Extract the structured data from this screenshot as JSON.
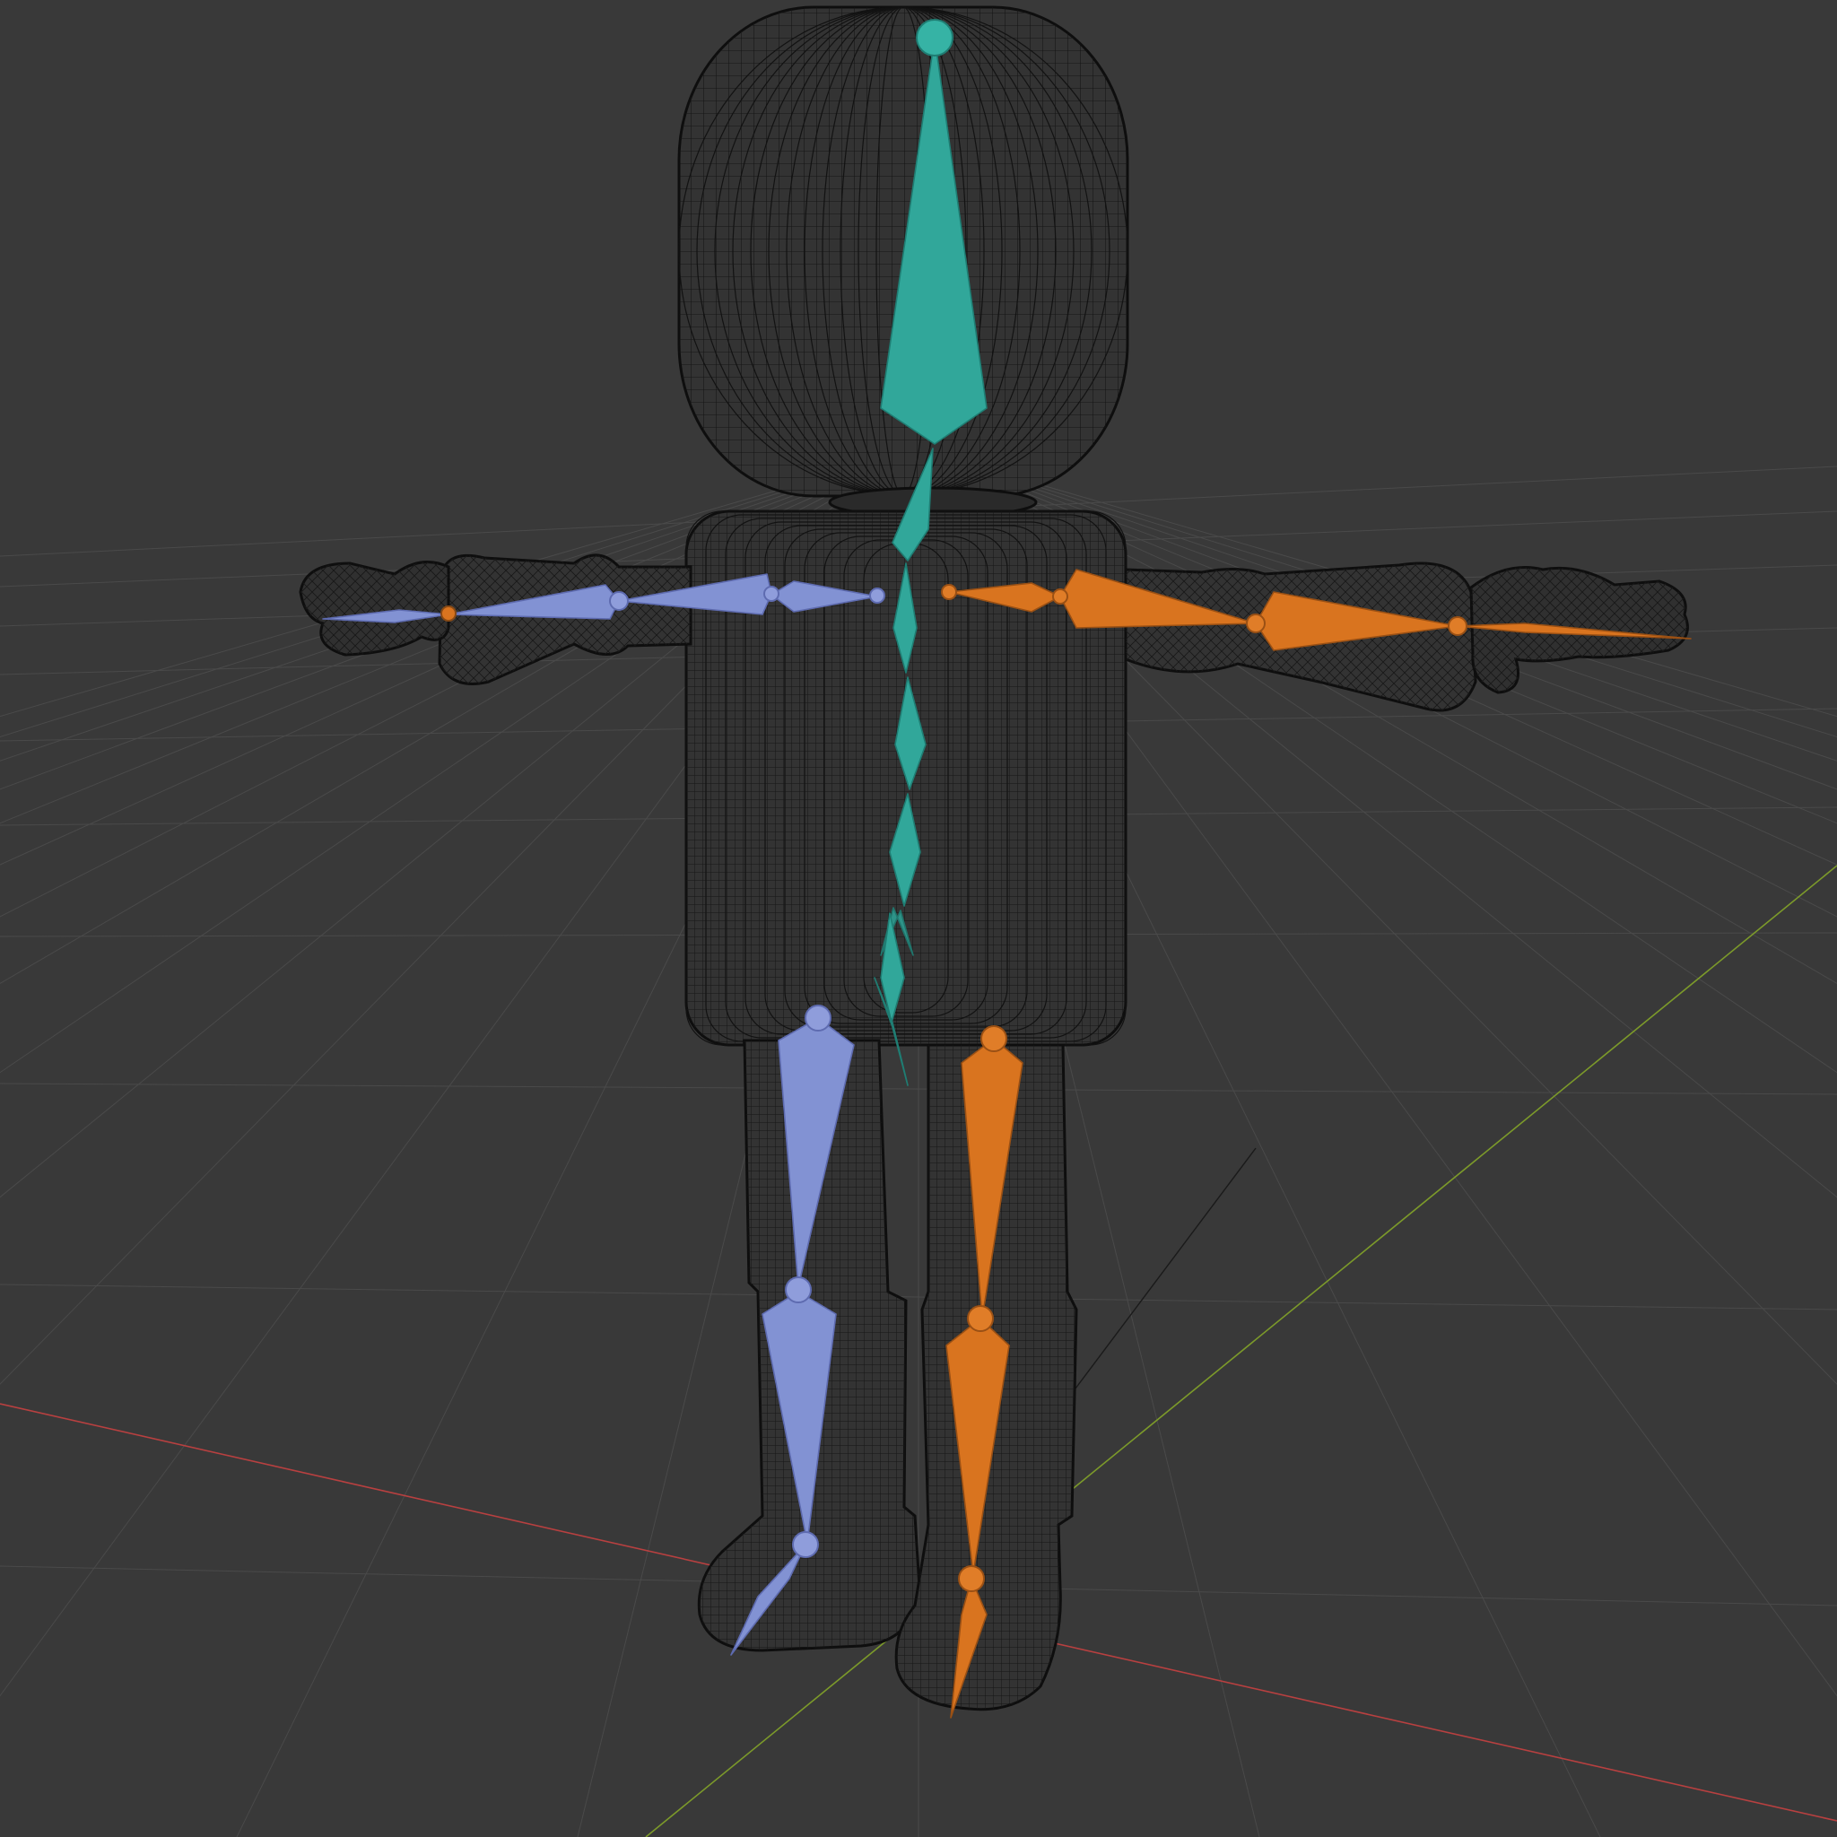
{
  "viewport": {
    "background": "#393939",
    "grid_color": "#4a4a4a",
    "axis_x_color": "#b84040",
    "axis_y_color": "#7c9a2a",
    "mesh_color": "#111111"
  },
  "armature": {
    "spine_color": "#2fa89a",
    "left_color": "#7f8fd1",
    "right_color": "#d9741f"
  },
  "icons": {
    "mesh": "wireframe-character-mesh",
    "armature": "armature-bones"
  }
}
